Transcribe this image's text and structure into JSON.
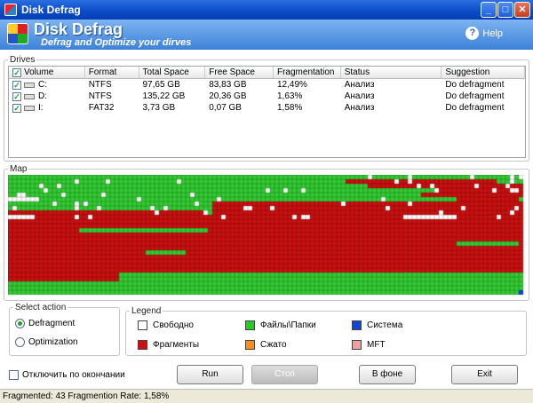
{
  "window": {
    "title": "Disk Defrag",
    "minimize": "_",
    "maximize": "□",
    "close": "✕"
  },
  "header": {
    "app_name": "Disk Defrag",
    "subtitle": "Defrag and Optimize your dirves",
    "help_label": "Help",
    "help_glyph": "?"
  },
  "drives": {
    "group_label": "Drives",
    "columns": [
      "Volume",
      "Format",
      "Total Space",
      "Free Space",
      "Fragmentation",
      "Status",
      "Suggestion"
    ],
    "rows": [
      {
        "volume": "C:",
        "format": "NTFS",
        "total": "97,65 GB",
        "free": "83,83 GB",
        "frag": "12,49%",
        "status": "Анализ",
        "suggestion": "Do defragment"
      },
      {
        "volume": "D:",
        "format": "NTFS",
        "total": "135,22 GB",
        "free": "20,36 GB",
        "frag": "1,63%",
        "status": "Анализ",
        "suggestion": "Do defragment"
      },
      {
        "volume": "I:",
        "format": "FAT32",
        "total": "3,73 GB",
        "free": "0,07 GB",
        "frag": "1,58%",
        "status": "Анализ",
        "suggestion": "Do defragment"
      }
    ],
    "check_glyph": "✓"
  },
  "map": {
    "group_label": "Map",
    "colors": {
      "free": "#ffffff",
      "files": "#33cc33",
      "fragments": "#cc1111",
      "system": "#1144dd"
    }
  },
  "action": {
    "group_label": "Select action",
    "options": [
      "Defragment",
      "Optimization"
    ],
    "selected": "Defragment"
  },
  "legend": {
    "group_label": "Legend",
    "items": [
      {
        "label": "Свободно",
        "color": "#ffffff"
      },
      {
        "label": "Файлы\\Папки",
        "color": "#22cc22"
      },
      {
        "label": "Система",
        "color": "#1144dd"
      },
      {
        "label": "Фрагменты",
        "color": "#cc1111"
      },
      {
        "label": "Сжато",
        "color": "#ff8c1a"
      },
      {
        "label": "MFT",
        "color": "#f0a0a0"
      }
    ]
  },
  "options": {
    "shutdown_label": "Отключить по окончании"
  },
  "buttons": {
    "run": "Run",
    "stop": "Стоп",
    "background": "В фоне",
    "exit": "Exit"
  },
  "status": {
    "text": "Fragmented: 43 Fragmention Rate: 1,58%"
  }
}
